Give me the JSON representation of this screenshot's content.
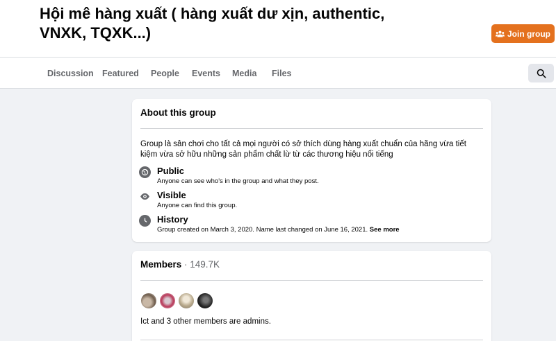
{
  "header": {
    "title": "Hội mê hàng xuất ( hàng xuất dư xịn, authentic, VNXK, TQXK...)",
    "join_label": "Join group",
    "join_icon": "people-icon",
    "accent_color": "#e4711e"
  },
  "tabs": [
    {
      "label": "Discussion"
    },
    {
      "label": "Featured"
    },
    {
      "label": "People"
    },
    {
      "label": "Events"
    },
    {
      "label": "Media"
    },
    {
      "label": "Files"
    }
  ],
  "search": {
    "icon": "search-icon"
  },
  "about": {
    "heading": "About this group",
    "description": "Group là sân chơi cho tất cả mọi người có sở thích dùng hàng xuất chuẩn của hãng vừa tiết kiệm vừa sở hữu những sản phẩm chất lừ từ các thương hiệu nổi tiếng",
    "items": [
      {
        "icon": "globe-icon",
        "title": "Public",
        "subtitle": "Anyone can see who's in the group and what they post."
      },
      {
        "icon": "eye-icon",
        "title": "Visible",
        "subtitle": "Anyone can find this group."
      },
      {
        "icon": "clock-icon",
        "title": "History",
        "subtitle": "Group created on March 3, 2020. Name last changed on June 16, 2021.",
        "link": "See more"
      }
    ]
  },
  "members": {
    "heading": "Members",
    "count": " · 149.7K",
    "admins_text": "Ict and 3 other members are admins."
  }
}
